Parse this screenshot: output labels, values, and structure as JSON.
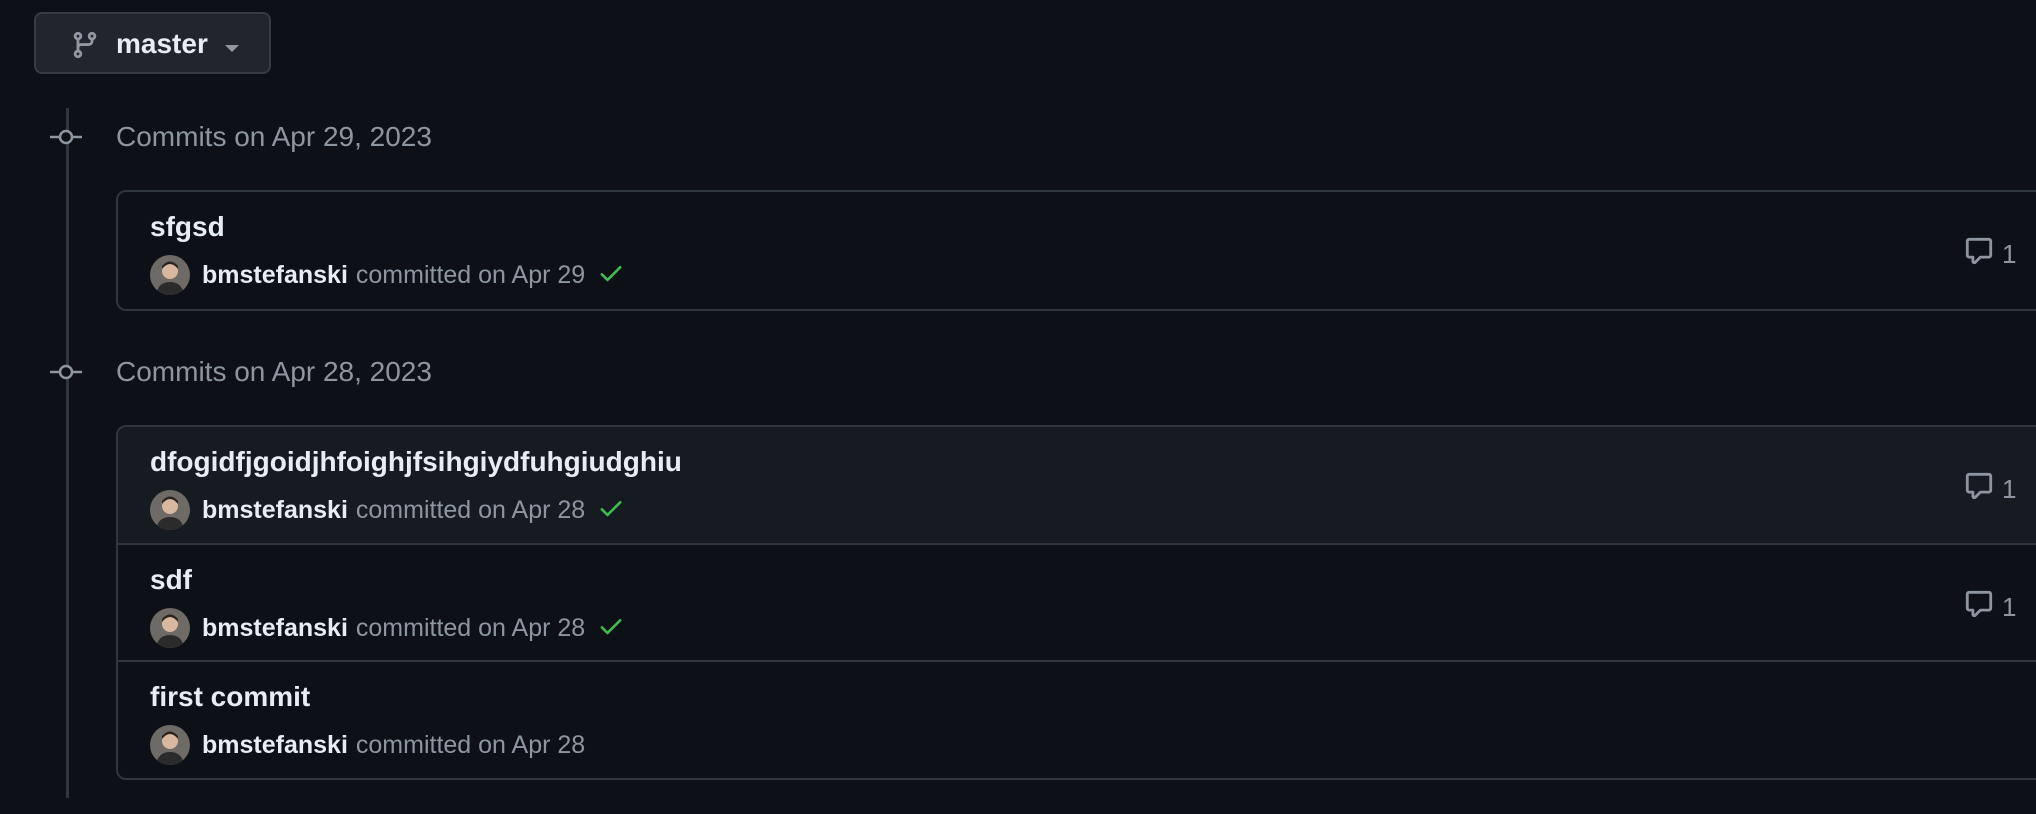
{
  "branch": {
    "name": "master",
    "icon": "git-branch-icon"
  },
  "groups": [
    {
      "header": "Commits on Apr 29, 2023",
      "commits": [
        {
          "message": "sfgsd",
          "author": "bmstefanski",
          "committed": "committed on Apr 29",
          "status": "success",
          "comments": "1"
        }
      ]
    },
    {
      "header": "Commits on Apr 28, 2023",
      "commits": [
        {
          "message": "dfogidfjgoidjhfoighjfsihgiydfuhgiudghiu",
          "author": "bmstefanski",
          "committed": "committed on Apr 28",
          "status": "success",
          "comments": "1"
        },
        {
          "message": "sdf",
          "author": "bmstefanski",
          "committed": "committed on Apr 28",
          "status": "success",
          "comments": "1"
        },
        {
          "message": "first commit",
          "author": "bmstefanski",
          "committed": "committed on Apr 28",
          "status": "none",
          "comments": ""
        }
      ]
    }
  ],
  "colors": {
    "background": "#0d1117",
    "border": "#30363d",
    "muted": "#8d96a0",
    "success": "#3fb950",
    "text": "#e6edf3"
  }
}
